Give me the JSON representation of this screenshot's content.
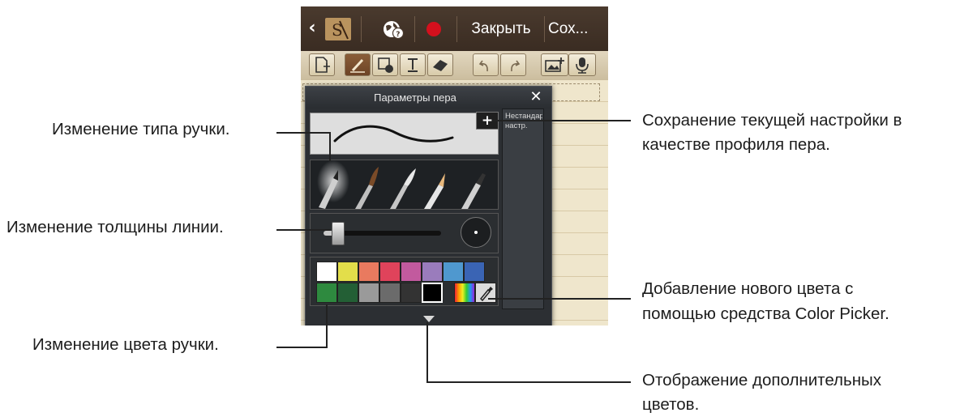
{
  "app": {
    "toolbar": {
      "close_label": "Закрыть",
      "save_label": "Сох..."
    },
    "pen_settings": {
      "title": "Параметры пера",
      "close_symbol": "✕",
      "add_symbol": "+",
      "profile_label": "Нестандарт. настр.",
      "colors_row1": [
        "#ffffff",
        "#e3de4a",
        "#e97a5f",
        "#e0435b",
        "#c25a9e",
        "#9a7cbc",
        "#4f98cf",
        "#3a64b4"
      ],
      "colors_row2": [
        "#2e8a3f",
        "#235f35",
        "#9a9a9a",
        "#6b6b6b",
        "#333333",
        "#000000"
      ],
      "selected_color": "#000000",
      "thickness_level": 0.12
    }
  },
  "callouts": {
    "pen_type": "Изменение типа ручки.",
    "line_thickness": "Изменение толщины линии.",
    "pen_color": "Изменение цвета ручки.",
    "save_profile_line1": "Сохранение текущей настройки в",
    "save_profile_line2": "качестве профиля пера.",
    "color_picker_line1": "Добавление нового цвета с",
    "color_picker_line2": "помощью средства Color Picker.",
    "more_colors_line1": "Отображение дополнительных",
    "more_colors_line2": "цветов."
  }
}
